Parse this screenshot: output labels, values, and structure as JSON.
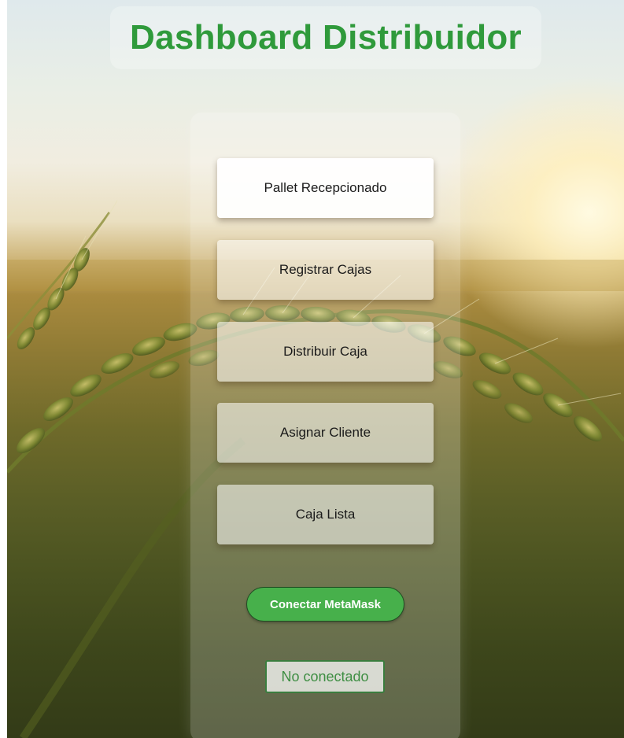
{
  "header": {
    "title": "Dashboard Distribuidor"
  },
  "menu": {
    "items": [
      {
        "label": "Pallet Recepcionado"
      },
      {
        "label": "Registrar Cajas"
      },
      {
        "label": "Distribuir Caja"
      },
      {
        "label": "Asignar Cliente"
      },
      {
        "label": "Caja Lista"
      }
    ]
  },
  "wallet": {
    "connect_label": "Conectar MetaMask",
    "status": "No conectado"
  },
  "colors": {
    "title": "#2f9a3b",
    "connect_button": "#47b04b",
    "status_text": "#3e8e43"
  },
  "background": {
    "icon": "wheat-field-photo"
  }
}
